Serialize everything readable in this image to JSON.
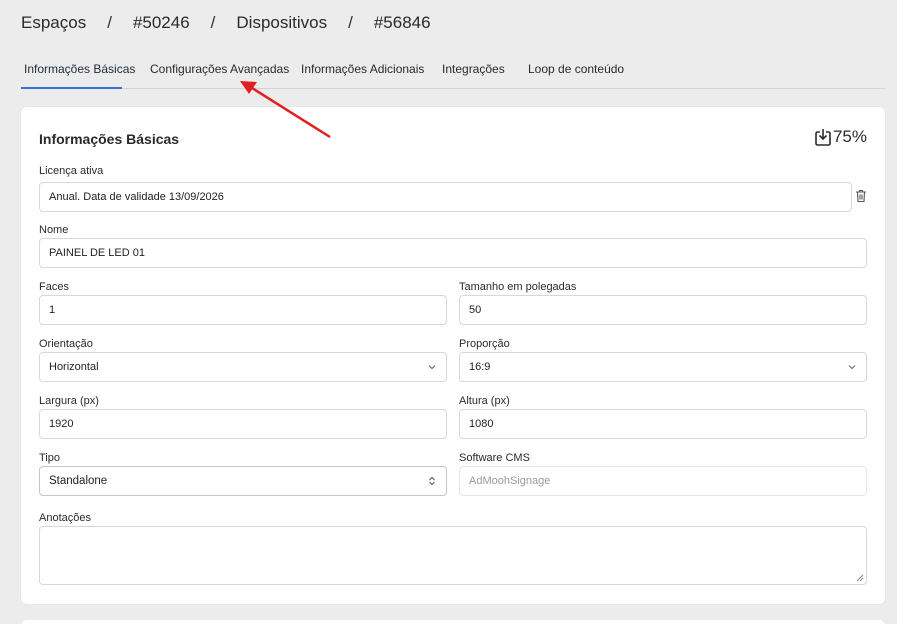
{
  "breadcrumb": {
    "items": [
      "Espaços",
      "#50246",
      "Dispositivos",
      "#56846"
    ],
    "separator": "/"
  },
  "tabs": [
    {
      "label": "Informações Básicas",
      "active": true
    },
    {
      "label": "Configurações Avançadas",
      "active": false
    },
    {
      "label": "Informações Adicionais",
      "active": false
    },
    {
      "label": "Integrações",
      "active": false
    },
    {
      "label": "Loop de conteúdo",
      "active": false
    }
  ],
  "card": {
    "title": "Informações Básicas",
    "progress": "75%",
    "progress_icon": "download-box-icon"
  },
  "form": {
    "license": {
      "label": "Licença ativa",
      "value": "Anual. Data de validade 13/09/2026"
    },
    "name": {
      "label": "Nome",
      "value": "PAINEL DE LED 01"
    },
    "faces": {
      "label": "Faces",
      "value": "1"
    },
    "size": {
      "label": "Tamanho em polegadas",
      "value": "50"
    },
    "orientation": {
      "label": "Orientação",
      "value": "Horizontal"
    },
    "ratio": {
      "label": "Proporção",
      "value": "16:9"
    },
    "width": {
      "label": "Largura (px)",
      "value": "1920"
    },
    "height": {
      "label": "Altura (px)",
      "value": "1080"
    },
    "type": {
      "label": "Tipo",
      "value": "Standalone"
    },
    "cms": {
      "label": "Software CMS",
      "placeholder": "AdMoohSignage"
    },
    "notes": {
      "label": "Anotações",
      "value": ""
    }
  },
  "colors": {
    "accent": "#3b6fd6",
    "annotation_arrow": "#e02020"
  }
}
